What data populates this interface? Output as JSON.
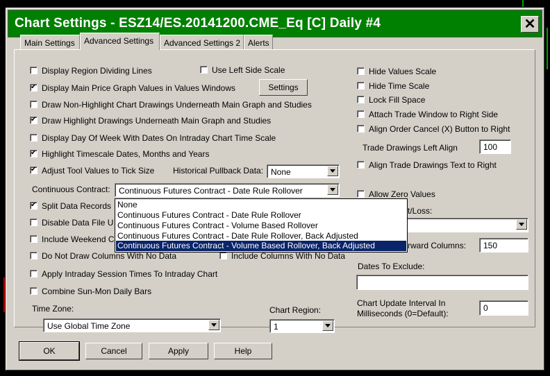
{
  "window": {
    "title": "Chart Settings - ESZ14/ES.20141200.CME_Eq [C]  Daily  #4",
    "close_glyph": "✕"
  },
  "tabs": [
    {
      "label": "Main Settings",
      "active": false
    },
    {
      "label": "Advanced Settings",
      "active": true
    },
    {
      "label": "Advanced Settings 2",
      "active": false
    },
    {
      "label": "Alerts",
      "active": false
    }
  ],
  "left_options": {
    "display_region_dividing_lines": {
      "label": "Display Region Dividing Lines",
      "checked": false
    },
    "use_left_side_scale": {
      "label": "Use Left Side Scale",
      "checked": false
    },
    "display_main_price_values": {
      "label": "Display Main Price Graph Values in Values Windows",
      "checked": true
    },
    "settings_button": "Settings",
    "draw_non_highlight": {
      "label": "Draw Non-Highlight Chart Drawings Underneath Main Graph and Studies",
      "checked": false
    },
    "draw_highlight": {
      "label": "Draw Highlight Drawings Underneath Main Graph and Studies",
      "checked": true
    },
    "display_day_of_week": {
      "label": "Display Day Of Week With Dates On Intraday Chart Time Scale",
      "checked": false
    },
    "highlight_timescale": {
      "label": "Highlight Timescale Dates, Months and Years",
      "checked": true
    },
    "adjust_tool_values": {
      "label": "Adjust Tool Values to Tick Size",
      "checked": true
    },
    "historical_pullback_label": "Historical Pullback Data:",
    "historical_pullback_value": "None",
    "continuous_contract_label": "Continuous Contract:",
    "continuous_contract_value": "Continuous Futures Contract - Date Rule Rollover",
    "split_data_records": {
      "label": "Split Data Records",
      "checked": true
    },
    "disable_data_file": {
      "label": "Disable Data File U",
      "checked": false
    },
    "include_weekend": {
      "label": "Include Weekend C",
      "checked": false
    },
    "do_not_draw_columns": {
      "label": "Do Not Draw Columns With No Data",
      "checked": false
    },
    "include_columns_no_data": {
      "label": "Include Columns With No Data",
      "checked": false
    },
    "apply_intraday_session": {
      "label": "Apply Intraday Session Times To Intraday Chart",
      "checked": false
    },
    "combine_sun_mon": {
      "label": "Combine Sun-Mon Daily Bars",
      "checked": false
    },
    "time_zone_label": "Time Zone:",
    "time_zone_value": "Use Global Time Zone",
    "chart_region_label": "Chart Region:",
    "chart_region_value": "1"
  },
  "right_options": {
    "hide_values_scale": {
      "label": "Hide Values Scale",
      "checked": false
    },
    "hide_time_scale": {
      "label": "Hide Time Scale",
      "checked": false
    },
    "lock_fill_space": {
      "label": "Lock Fill Space",
      "checked": false
    },
    "attach_trade_window": {
      "label": "Attach Trade Window to Right Side",
      "checked": false
    },
    "align_order_cancel": {
      "label": "Align Order Cancel (X) Button to Right",
      "checked": false
    },
    "trade_drawings_left_align_label": "Trade Drawings Left Align",
    "trade_drawings_left_align_value": "100",
    "align_trade_drawings_text": {
      "label": "Align Trade Drawings Text to Right",
      "checked": false
    },
    "allow_zero_values": {
      "label": "Allow Zero Values",
      "checked": false
    },
    "profit_loss_label_partial": "t/Loss:",
    "forward_columns_label_partial": "rward Columns:",
    "forward_columns_value": "150",
    "dates_to_exclude_label": "Dates To Exclude:",
    "dates_to_exclude_value": "",
    "chart_update_interval_label_1": "Chart Update Interval In",
    "chart_update_interval_label_2": "Milliseconds (0=Default):",
    "chart_update_interval_value": "0"
  },
  "dropdown_options": [
    {
      "label": "None",
      "selected": false
    },
    {
      "label": "Continuous Futures Contract - Date Rule Rollover",
      "selected": false
    },
    {
      "label": "Continuous Futures Contract - Volume Based Rollover",
      "selected": false
    },
    {
      "label": "Continuous Futures Contract - Date Rule Rollover, Back Adjusted",
      "selected": false
    },
    {
      "label": "Continuous Futures Contract - Volume Based Rollover, Back Adjusted",
      "selected": true
    }
  ],
  "footer": {
    "ok": "OK",
    "cancel": "Cancel",
    "apply": "Apply",
    "help": "Help"
  },
  "colors": {
    "title_bar": "#008000",
    "selection": "#0a246a",
    "dialog_face": "#d4d0c8"
  }
}
